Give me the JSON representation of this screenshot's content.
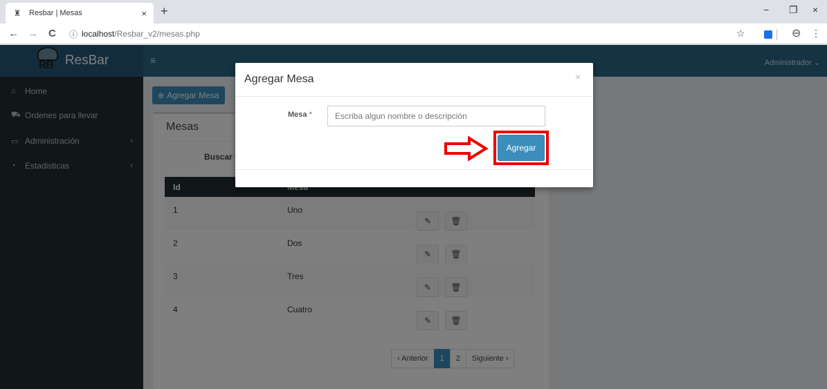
{
  "browser": {
    "tab_title": "Resbar | Mesas",
    "tab_close": "×",
    "new_tab": "+",
    "url_host": "localhost",
    "url_path": "/Resbar_v2/mesas.php",
    "win_minimize": "−",
    "win_restore": "❐",
    "win_close": "×",
    "back": "←",
    "forward": "→",
    "reload": "C",
    "info": "ⓘ",
    "star": "☆",
    "profile": "⊖",
    "menu": "⋮"
  },
  "app": {
    "brand_mark": "RB",
    "brand_name": "ResBar",
    "hamburger": "≡",
    "user_menu": "Administrador ⌄"
  },
  "sidebar": {
    "items": [
      {
        "icon": "home-icon",
        "glyph": "⌂",
        "label": "Home",
        "caret": ""
      },
      {
        "icon": "car-icon",
        "glyph": "⛟",
        "label": "Ordenes para llevar",
        "caret": ""
      },
      {
        "icon": "laptop-icon",
        "glyph": "▭",
        "label": "Administración",
        "caret": "‹"
      },
      {
        "icon": "pie-chart-icon",
        "glyph": "◔",
        "label": "Estadisticas",
        "caret": "‹"
      }
    ]
  },
  "main": {
    "add_button": "Agregar Mesa",
    "add_icon": "⊕",
    "panel_title": "Mesas",
    "search_label": "Buscar M",
    "columns": [
      "Id",
      "Mesa"
    ],
    "rows": [
      {
        "id": "1",
        "mesa": "Uno"
      },
      {
        "id": "2",
        "mesa": "Dos"
      },
      {
        "id": "3",
        "mesa": "Tres"
      },
      {
        "id": "4",
        "mesa": "Cuatro"
      }
    ],
    "edit_glyph": "✎",
    "delete_glyph": "🗑",
    "pagination": {
      "prev": "‹ Anterior",
      "pages": [
        "1",
        "2"
      ],
      "active": "1",
      "next": "Siguiente ›"
    }
  },
  "modal": {
    "title": "Agregar Mesa",
    "close": "×",
    "field_label": "Mesa",
    "required_mark": "*",
    "field_value": "",
    "field_placeholder": "Escriba algun nombre o descripción",
    "submit_label": "Agregar"
  },
  "colors": {
    "header": "#2d6687",
    "sidebar": "#222d32",
    "primary": "#3c8dbc",
    "highlight": "#ee0000"
  }
}
